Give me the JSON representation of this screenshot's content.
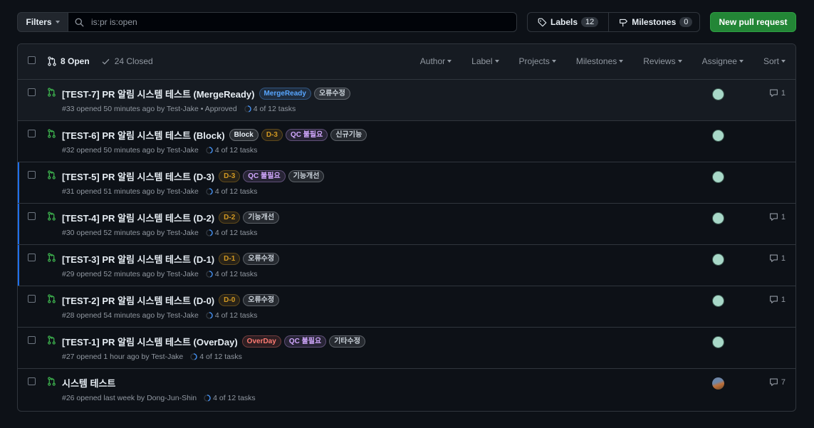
{
  "toolbar": {
    "filters_label": "Filters",
    "search_value": "is:pr is:open",
    "labels_label": "Labels",
    "labels_count": "12",
    "milestones_label": "Milestones",
    "milestones_count": "0",
    "new_pr_label": "New pull request"
  },
  "header": {
    "open_label": "8 Open",
    "closed_label": "24 Closed",
    "menus": [
      "Author",
      "Label",
      "Projects",
      "Milestones",
      "Reviews",
      "Assignee",
      "Sort"
    ]
  },
  "prs": [
    {
      "title": "[TEST-7] PR 알림 시스템 테스트 (MergeReady)",
      "labels": [
        {
          "text": "MergeReady",
          "color": "#58a6ff"
        },
        {
          "text": "오류수정",
          "color": "#c9d1d9"
        }
      ],
      "meta": "#33 opened 50 minutes ago by Test-Jake • Approved",
      "tasks": "4 of 12 tasks",
      "avatar": "green",
      "comments": "1",
      "blue": false,
      "hl": true
    },
    {
      "title": "[TEST-6] PR 알림 시스템 테스트 (Block)",
      "labels": [
        {
          "text": "Block",
          "color": "#e6edf3"
        },
        {
          "text": "D-3",
          "color": "#d29922"
        },
        {
          "text": "QC 불필요",
          "color": "#d2a8ff"
        },
        {
          "text": "신규기능",
          "color": "#c9d1d9"
        }
      ],
      "meta": "#32 opened 50 minutes ago by Test-Jake",
      "tasks": "4 of 12 tasks",
      "avatar": "green",
      "comments": "",
      "blue": false,
      "hl": false
    },
    {
      "title": "[TEST-5] PR 알림 시스템 테스트 (D-3)",
      "labels": [
        {
          "text": "D-3",
          "color": "#d29922"
        },
        {
          "text": "QC 불필요",
          "color": "#d2a8ff"
        },
        {
          "text": "기능개선",
          "color": "#c9d1d9"
        }
      ],
      "meta": "#31 opened 51 minutes ago by Test-Jake",
      "tasks": "4 of 12 tasks",
      "avatar": "green",
      "comments": "",
      "blue": true,
      "hl": false
    },
    {
      "title": "[TEST-4] PR 알림 시스템 테스트 (D-2)",
      "labels": [
        {
          "text": "D-2",
          "color": "#d29922"
        },
        {
          "text": "기능개선",
          "color": "#c9d1d9"
        }
      ],
      "meta": "#30 opened 52 minutes ago by Test-Jake",
      "tasks": "4 of 12 tasks",
      "avatar": "green",
      "comments": "1",
      "blue": true,
      "hl": false
    },
    {
      "title": "[TEST-3] PR 알림 시스템 테스트 (D-1)",
      "labels": [
        {
          "text": "D-1",
          "color": "#d29922"
        },
        {
          "text": "오류수정",
          "color": "#c9d1d9"
        }
      ],
      "meta": "#29 opened 52 minutes ago by Test-Jake",
      "tasks": "4 of 12 tasks",
      "avatar": "green",
      "comments": "1",
      "blue": true,
      "hl": false
    },
    {
      "title": "[TEST-2] PR 알림 시스템 테스트 (D-0)",
      "labels": [
        {
          "text": "D-0",
          "color": "#d29922"
        },
        {
          "text": "오류수정",
          "color": "#c9d1d9"
        }
      ],
      "meta": "#28 opened 54 minutes ago by Test-Jake",
      "tasks": "4 of 12 tasks",
      "avatar": "green",
      "comments": "1",
      "blue": false,
      "hl": false
    },
    {
      "title": "[TEST-1] PR 알림 시스템 테스트 (OverDay)",
      "labels": [
        {
          "text": "OverDay",
          "color": "#ff7b72"
        },
        {
          "text": "QC 불필요",
          "color": "#d2a8ff"
        },
        {
          "text": "기타수정",
          "color": "#c9d1d9"
        }
      ],
      "meta": "#27 opened 1 hour ago by Test-Jake",
      "tasks": "4 of 12 tasks",
      "avatar": "green",
      "comments": "",
      "blue": false,
      "hl": false
    },
    {
      "title": "시스템 테스트",
      "labels": [],
      "meta": "#26 opened last week by Dong-Jun-Shin",
      "tasks": "4 of 12 tasks",
      "avatar": "photo",
      "comments": "7",
      "blue": false,
      "hl": false
    }
  ]
}
